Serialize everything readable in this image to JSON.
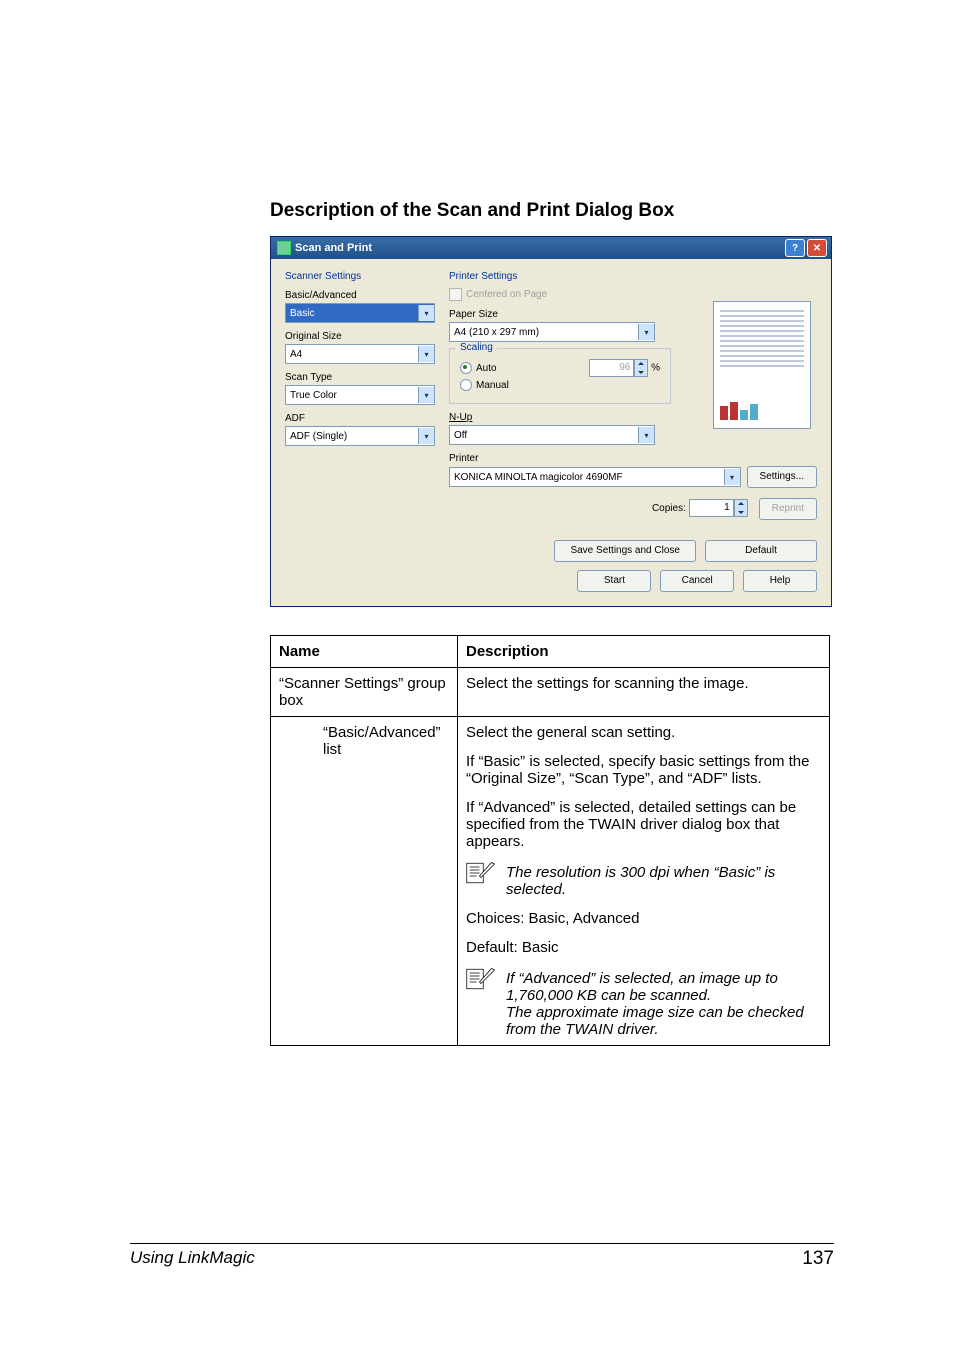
{
  "heading": "Description of the Scan and Print Dialog Box",
  "dialog": {
    "title": "Scan and Print",
    "scanner_settings": {
      "section": "Scanner Settings",
      "basic_adv_label": "Basic/Advanced",
      "basic_adv_value": "Basic",
      "original_size_label": "Original Size",
      "original_size_value": "A4",
      "scan_type_label": "Scan Type",
      "scan_type_value": "True Color",
      "adf_label": "ADF",
      "adf_value": "ADF (Single)"
    },
    "printer_settings": {
      "section": "Printer Settings",
      "centered": "Centered on Page",
      "paper_size_label": "Paper Size",
      "paper_size_value": "A4 (210 x 297 mm)",
      "scaling_legend": "Scaling",
      "auto": "Auto",
      "manual": "Manual",
      "percent": "%",
      "percent_value": "96",
      "nup_label": "N-Up",
      "nup_value": "Off",
      "printer_label": "Printer",
      "printer_value": "KONICA MINOLTA magicolor 4690MF",
      "settings_btn": "Settings...",
      "copies_label": "Copies:",
      "copies_value": "1",
      "reprint_btn": "Reprint"
    },
    "buttons": {
      "save_close": "Save Settings and Close",
      "default": "Default",
      "start": "Start",
      "cancel": "Cancel",
      "help": "Help"
    }
  },
  "table": {
    "h_name": "Name",
    "h_desc": "Description",
    "r1_name": "“Scanner Settings” group box",
    "r1_desc": "Select the settings for scanning the image.",
    "r2_name": "“Basic/Advanced” list",
    "r2_p1": "Select the general scan setting.",
    "r2_p2": "If “Basic” is selected, specify basic settings from the “Original Size”, “Scan Type”, and “ADF” lists.",
    "r2_p3": "If “Advanced” is selected, detailed settings can be specified from the TWAIN driver dialog box that appears.",
    "r2_note1": "The resolution is 300 dpi when “Basic” is selected.",
    "r2_p4": "Choices: Basic, Advanced",
    "r2_p5": "Default: Basic",
    "r2_note2": "If “Advanced” is selected, an image up to 1,760,000 KB can be scanned.\nThe approximate image size can be checked from the TWAIN driver."
  },
  "footer": {
    "left": "Using LinkMagic",
    "right": "137"
  }
}
